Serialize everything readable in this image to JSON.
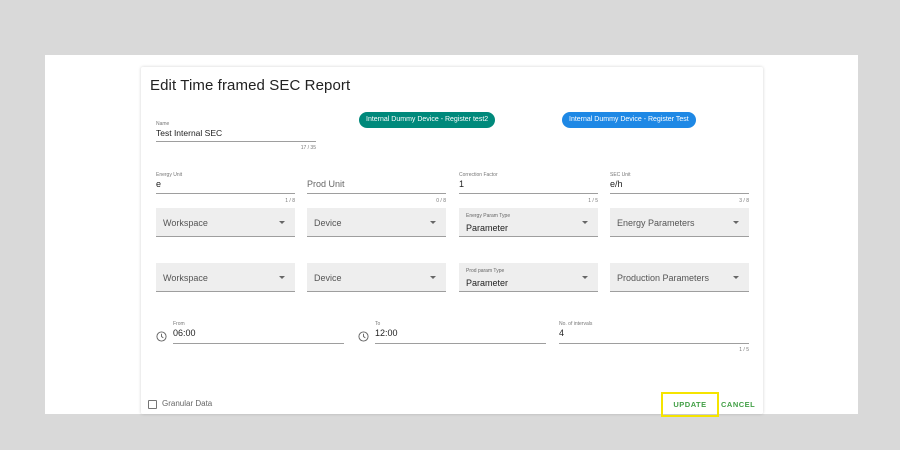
{
  "dialog": {
    "title": "Edit Time framed SEC Report"
  },
  "name_field": {
    "label": "Name",
    "value": "Test Internal SEC",
    "counter": "17 / 35"
  },
  "chips": [
    {
      "label": "Internal Dummy Device - Register test2",
      "color": "#00897b"
    },
    {
      "label": "Internal Dummy Device - Register Test",
      "color": "#1e88e5"
    }
  ],
  "units_row": [
    {
      "label": "Energy Unit",
      "value": "e",
      "counter": "1 / 8"
    },
    {
      "label": "",
      "value": "Prod Unit",
      "counter": "0 / 8"
    },
    {
      "label": "Correction Factor",
      "value": "1",
      "counter": "1 / 5"
    },
    {
      "label": "SEC Unit",
      "value": "e/h",
      "counter": "3 / 8"
    }
  ],
  "energy_row": {
    "workspace": "Workspace",
    "device": "Device",
    "param_type_label": "Energy Param Type",
    "param_type_value": "Parameter",
    "parameters": "Energy Parameters"
  },
  "production_row": {
    "workspace": "Workspace",
    "device": "Device",
    "param_type_label": "Prod param Type",
    "param_type_value": "Parameter",
    "parameters": "Production Parameters"
  },
  "time_row": {
    "from_label": "From",
    "from_value": "06:00",
    "to_label": "To",
    "to_value": "12:00",
    "intervals_label": "No. of intervals",
    "intervals_value": "4",
    "intervals_counter": "1 / 5"
  },
  "footer": {
    "granular_label": "Granular Data",
    "update_label": "UPDATE",
    "cancel_label": "CANCEL"
  },
  "icons": {
    "clock": "clock-icon",
    "caret": "chevron-down-icon",
    "checkbox": "checkbox-unchecked-icon"
  }
}
